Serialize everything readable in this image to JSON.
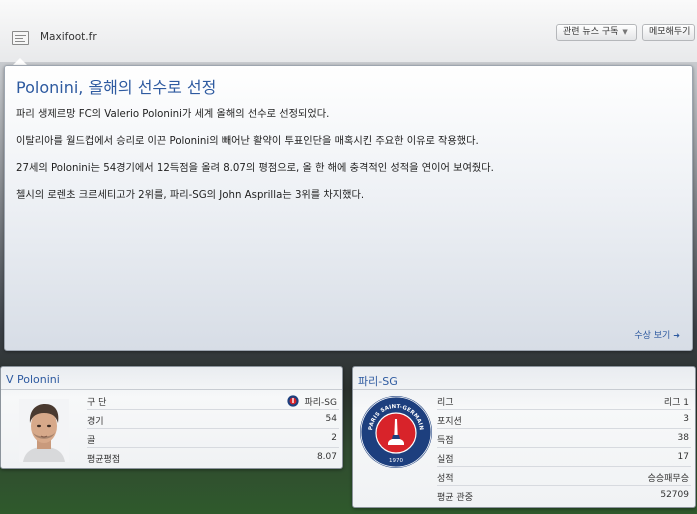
{
  "header": {
    "source_name": "Maxifoot.fr",
    "subscribe_button": "관련 뉴스 구독",
    "memo_button": "메모해두기"
  },
  "article": {
    "headline": "Polonini, 올해의 선수로 선정",
    "paragraphs": [
      "파리 생제르망 FC의 Valerio Polonini가 세계 올해의 선수로 선정되었다.",
      "이탈리아를 월드컵에서 승리로 이끈 Polonini의 빼어난 활약이 투표인단을 매혹시킨 주요한 이유로 작용했다.",
      "27세의 Polonini는 54경기에서 12득점을 올려 8.07의 평점으로, 올 한 해에 충격적인 성적을 연이어 보여줬다.",
      "첼시의 로렌초 크르세티고가 2위를, 파리-SG의 John Asprilla는 3위를 차지했다."
    ],
    "awards_link": "수상 보기"
  },
  "player_card": {
    "title": "V Polonini",
    "rows": [
      {
        "label": "구 단",
        "value": "파리-SG"
      },
      {
        "label": "경기",
        "value": "54"
      },
      {
        "label": "골",
        "value": "2"
      },
      {
        "label": "평균평점",
        "value": "8.07"
      }
    ]
  },
  "club_card": {
    "title": "파리-SG",
    "crest_text_top": "PARIS SAINT-GERMAIN",
    "crest_year": "1970",
    "rows": [
      {
        "label": "리그",
        "value": "리그 1"
      },
      {
        "label": "포지션",
        "value": "3"
      },
      {
        "label": "득점",
        "value": "38"
      },
      {
        "label": "실점",
        "value": "17"
      },
      {
        "label": "성적",
        "value": "승승패무승"
      },
      {
        "label": "평균 관중",
        "value": "52709"
      }
    ]
  },
  "colors": {
    "accent": "#2e5aa0",
    "club_blue": "#1d3f7e",
    "club_red": "#d8232a"
  }
}
